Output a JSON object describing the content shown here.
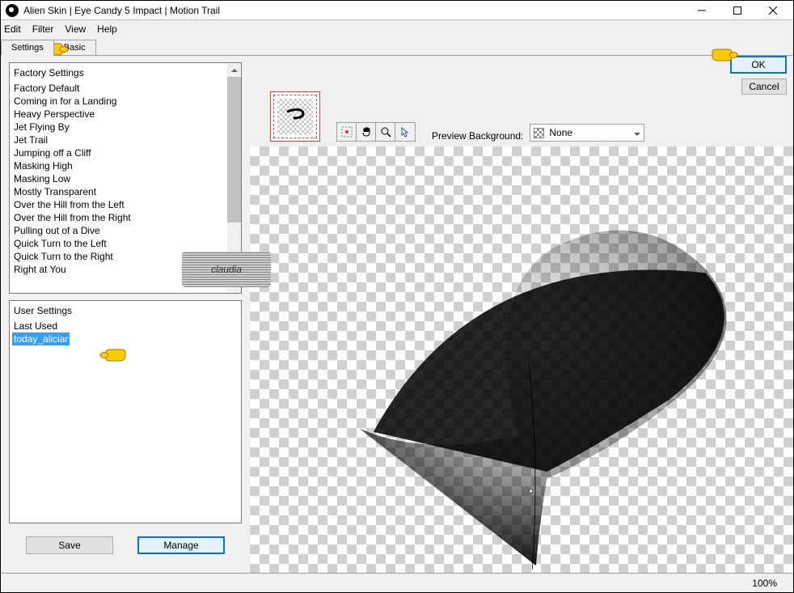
{
  "title": "Alien Skin | Eye Candy 5 Impact | Motion Trail",
  "menubar": {
    "edit": "Edit",
    "filter": "Filter",
    "view": "View",
    "help": "Help"
  },
  "tabs": {
    "settings": "Settings",
    "basic": "Basic"
  },
  "factory": {
    "header": "Factory Settings",
    "items": [
      "Factory Default",
      "Coming in for a Landing",
      "Heavy Perspective",
      "Jet Flying By",
      "Jet Trail",
      "Jumping off a Cliff",
      "Masking High",
      "Masking Low",
      "Mostly Transparent",
      "Over the Hill from the Left",
      "Over the Hill from the Right",
      "Pulling out of a Dive",
      "Quick Turn to the Left",
      "Quick Turn to the Right",
      "Right at You"
    ]
  },
  "user": {
    "header": "User Settings",
    "last_used": "Last Used",
    "selected": "today_aliciar"
  },
  "buttons": {
    "save": "Save",
    "manage": "Manage",
    "ok": "OK",
    "cancel": "Cancel"
  },
  "preview_bg": {
    "label": "Preview Background:",
    "value": "None"
  },
  "zoom": "100%",
  "watermark": "claudia"
}
